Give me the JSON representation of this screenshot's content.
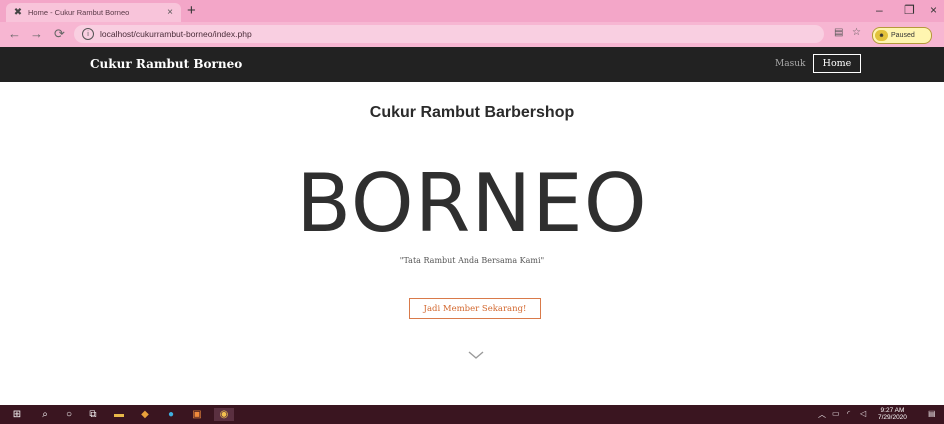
{
  "browser": {
    "tab_title": "Home - Cukur Rambut Borneo",
    "tab_close": "×",
    "new_tab": "+",
    "url": "localhost/cukurrambut-borneo/index.php",
    "profile_label": "Paused",
    "icons": [
      "x-logo-icon",
      "back-icon",
      "forward-icon",
      "reload-icon",
      "info-icon",
      "translate-icon",
      "star-icon",
      "minimize-icon",
      "restore-icon",
      "close-icon"
    ]
  },
  "navbar": {
    "brand": "Cukur Rambut Borneo",
    "links": [
      {
        "label": "Masuk"
      },
      {
        "label": "Home"
      }
    ]
  },
  "hero": {
    "subheading": "Cukur Rambut Barbershop",
    "title": "BORNEO",
    "tagline": "\"Tata Rambut Anda Bersama Kami\"",
    "cta_label": "Jadi Member Sekarang!"
  },
  "taskbar": {
    "time": "9:27 AM",
    "date": "7/29/2020"
  },
  "colors": {
    "browser_chrome": "#f7b6d2",
    "navbar_bg": "#222222",
    "cta_accent": "#d3682f",
    "taskbar_bg": "#3a1520"
  }
}
